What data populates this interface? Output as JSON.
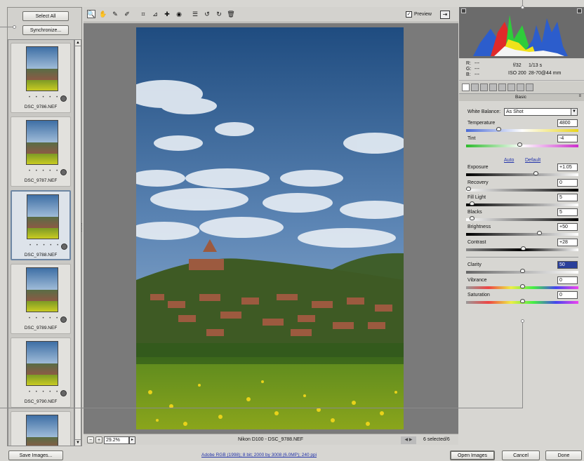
{
  "left_panel": {
    "select_all": "Select All",
    "synchronize": "Synchronize...",
    "thumbnails": [
      {
        "name": "DSC_9786.NEF",
        "rating": "• • • • •",
        "selected": false
      },
      {
        "name": "DSC_9787.NEF",
        "rating": "• • • • •",
        "selected": false
      },
      {
        "name": "DSC_9788.NEF",
        "rating": "• • • • •",
        "selected": true
      },
      {
        "name": "DSC_9789.NEF",
        "rating": "• • • • •",
        "selected": false
      },
      {
        "name": "DSC_9790.NEF",
        "rating": "• • • • •",
        "selected": false
      }
    ]
  },
  "toolbar": {
    "tools": [
      "zoom-icon",
      "hand-icon",
      "eyedropper-icon",
      "color-sampler-icon",
      "crop-icon",
      "straighten-icon",
      "retouch-icon",
      "red-eye-icon",
      "list-icon",
      "rotate-left-icon",
      "rotate-right-icon",
      "trash-icon"
    ],
    "preview_label": "Preview",
    "preview_checked": "✓"
  },
  "status": {
    "zoom": "29.2%",
    "minus": "−",
    "plus": "+",
    "filename": "Nikon D100  -  DSC_9788.NEF",
    "selected": "6 selected/6"
  },
  "info": {
    "r_label": "R:",
    "r_value": "---",
    "g_label": "G:",
    "g_value": "---",
    "b_label": "B:",
    "b_value": "---",
    "aperture": "f/32",
    "shutter": "1/13 s",
    "iso": "ISO 200",
    "lens": "28-70@44 mm"
  },
  "panel": {
    "title": "Basic",
    "white_balance_label": "White Balance:",
    "white_balance_value": "As Shot",
    "auto": "Auto",
    "default": "Default",
    "sliders": [
      {
        "label": "Temperature",
        "value": "4800",
        "level": 0.28
      },
      {
        "label": "Tint",
        "value": "-4",
        "level": 0.48
      },
      {
        "label": "Exposure",
        "value": "+1.05",
        "level": 0.63
      },
      {
        "label": "Recovery",
        "value": "0",
        "level": 0.0
      },
      {
        "label": "Fill Light",
        "value": "5",
        "level": 0.03
      },
      {
        "label": "Blacks",
        "value": "5",
        "level": 0.03
      },
      {
        "label": "Brightness",
        "value": "+50",
        "level": 0.66
      },
      {
        "label": "Contrast",
        "value": "+28",
        "level": 0.51
      },
      {
        "label": "Clarity",
        "value": "50",
        "level": 0.5
      },
      {
        "label": "Vibrance",
        "value": "0",
        "level": 0.5
      },
      {
        "label": "Saturation",
        "value": "0",
        "level": 0.5
      }
    ]
  },
  "bottom": {
    "save": "Save Images...",
    "color_info": "Adobe RGB (1998); 8 bit; 2000 by 3008 (6.0MP); 240 ppi",
    "open": "Open Images",
    "cancel": "Cancel",
    "done": "Done"
  }
}
